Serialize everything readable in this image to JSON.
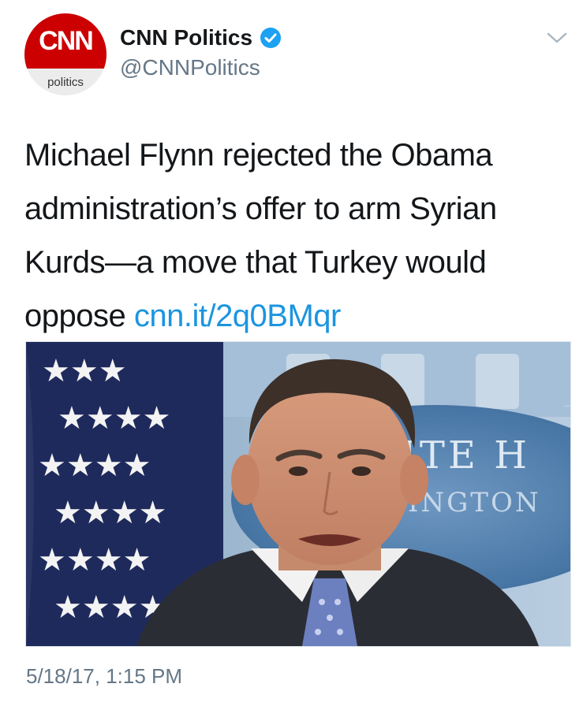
{
  "author": {
    "display_name": "CNN Politics",
    "handle": "@CNNPolitics",
    "verified": true,
    "avatar": {
      "logo_text": "CNN",
      "sub_text": "politics",
      "brand_color": "#cc0000"
    }
  },
  "tweet": {
    "text": "Michael Flynn rejected the Obama administration’s offer to arm Syrian Kurds—a move that Turkey would oppose ",
    "link": "cnn.it/2q0BMqr",
    "timestamp": "5/18/17, 1:15 PM"
  },
  "photo": {
    "background_sign_lines": [
      "HITE H",
      "SHINGTON"
    ]
  },
  "colors": {
    "link": "#1b95e0",
    "secondary_text": "#657786",
    "verified_badge": "#1da1f2"
  },
  "icons": {
    "verified": "verified-badge-icon",
    "menu": "chevron-down-icon"
  }
}
